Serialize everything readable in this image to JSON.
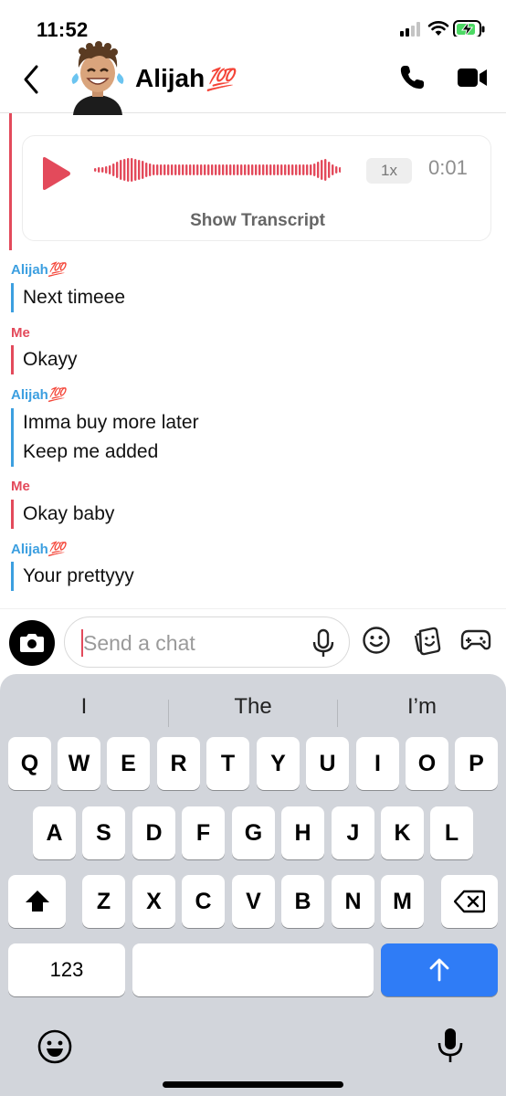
{
  "status": {
    "time": "11:52"
  },
  "header": {
    "contact_name": "Alijah",
    "contact_emoji": "💯"
  },
  "voice_note": {
    "speed": "1x",
    "duration": "0:01",
    "show_transcript": "Show Transcript"
  },
  "messages": [
    {
      "sender": "Alijah",
      "emoji": "💯",
      "from": "them",
      "lines": [
        "Next timeee"
      ]
    },
    {
      "sender": "Me",
      "emoji": "",
      "from": "me",
      "lines": [
        "Okayy"
      ]
    },
    {
      "sender": "Alijah",
      "emoji": "💯",
      "from": "them",
      "lines": [
        "Imma buy more later",
        "Keep me added"
      ]
    },
    {
      "sender": "Me",
      "emoji": "",
      "from": "me",
      "lines": [
        "Okay baby"
      ]
    },
    {
      "sender": "Alijah",
      "emoji": "💯",
      "from": "them",
      "lines": [
        "Your prettyyy"
      ]
    }
  ],
  "composer": {
    "placeholder": "Send a chat"
  },
  "keyboard": {
    "suggestions": [
      "I",
      "The",
      "I’m"
    ],
    "row1": [
      "Q",
      "W",
      "E",
      "R",
      "T",
      "Y",
      "U",
      "I",
      "O",
      "P"
    ],
    "row2": [
      "A",
      "S",
      "D",
      "F",
      "G",
      "H",
      "J",
      "K",
      "L"
    ],
    "row3": [
      "Z",
      "X",
      "C",
      "V",
      "B",
      "N",
      "M"
    ],
    "numbers_key": "123"
  },
  "colors": {
    "me": "#e34a5b",
    "them": "#3c9fe0",
    "return_key": "#2f7cf6"
  },
  "icons": [
    "back-chevron-icon",
    "phone-icon",
    "video-camera-icon",
    "play-icon",
    "camera-icon",
    "microphone-icon",
    "smiley-icon",
    "sticker-icon",
    "game-controller-icon",
    "shift-icon",
    "delete-icon",
    "return-arrow-icon",
    "emoji-keyboard-icon",
    "dictation-mic-icon"
  ]
}
